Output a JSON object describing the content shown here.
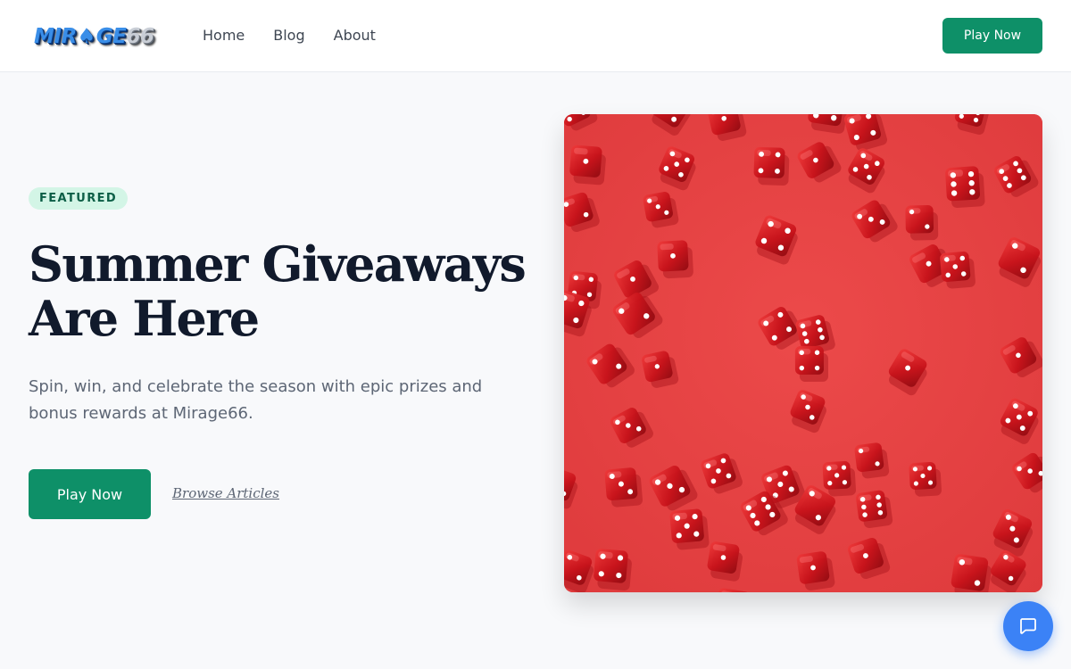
{
  "brand": {
    "logo_parts": [
      "MIR",
      "♠",
      "GE",
      "66"
    ],
    "logo_alt": "Mirage66"
  },
  "nav": {
    "items": [
      {
        "label": "Home"
      },
      {
        "label": "Blog"
      },
      {
        "label": "About"
      }
    ]
  },
  "header": {
    "cta_label": "Play Now"
  },
  "hero": {
    "badge": "FEATURED",
    "title_lines": [
      "Summer Giveaways",
      "Are Here"
    ],
    "subtitle": "Spin, win, and celebrate the season with epic prizes and bonus rewards at Mirage66.",
    "cta_label": "Play Now",
    "secondary_link": "Browse Articles",
    "image_subject": "red translucent dice on a red background"
  },
  "chat": {
    "icon": "chat-bubble-icon"
  },
  "colors": {
    "accent_green": "#0e9068",
    "badge_bg": "#d3f5e6",
    "badge_text": "#0c5e46",
    "chat_blue": "#3b82f6",
    "image_red": "#e64142",
    "dice_red": "#c8121a"
  }
}
